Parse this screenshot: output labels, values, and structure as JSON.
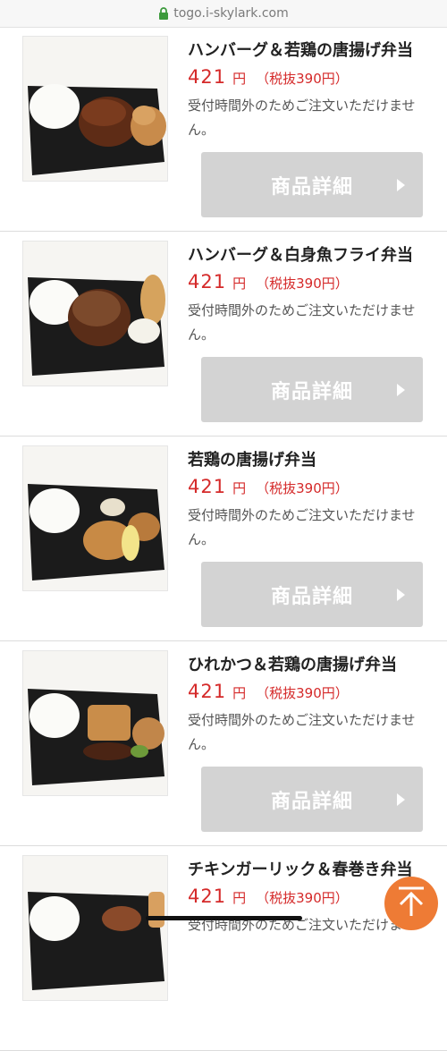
{
  "browser": {
    "url": "togo.i-skylark.com"
  },
  "items": [
    {
      "name": "ハンバーグ＆若鶏の唐揚げ弁当",
      "price": "421",
      "yen": "円",
      "tax_excluded": "（税抜390円）",
      "notice": "受付時間外のためご注文いただけません。",
      "button_label": "商品詳細"
    },
    {
      "name": "ハンバーグ＆白身魚フライ弁当",
      "price": "421",
      "yen": "円",
      "tax_excluded": "（税抜390円）",
      "notice": "受付時間外のためご注文いただけません。",
      "button_label": "商品詳細"
    },
    {
      "name": "若鶏の唐揚げ弁当",
      "price": "421",
      "yen": "円",
      "tax_excluded": "（税抜390円）",
      "notice": "受付時間外のためご注文いただけません。",
      "button_label": "商品詳細"
    },
    {
      "name": "ひれかつ＆若鶏の唐揚げ弁当",
      "price": "421",
      "yen": "円",
      "tax_excluded": "（税抜390円）",
      "notice": "受付時間外のためご注文いただけません。",
      "button_label": "商品詳細"
    },
    {
      "name": "チキンガーリック＆春巻き弁当",
      "price": "421",
      "yen": "円",
      "tax_excluded": "（税抜390円）",
      "notice": "受付時間外のためご注文いただけま",
      "button_label": ""
    }
  ],
  "colors": {
    "price": "#d52a2a",
    "button_disabled": "#d3d3d3",
    "back_to_top": "#ee7b35"
  },
  "icons": {
    "lock": "lock-icon",
    "arrow": "chevron-right-icon",
    "top": "arrow-up-icon"
  }
}
